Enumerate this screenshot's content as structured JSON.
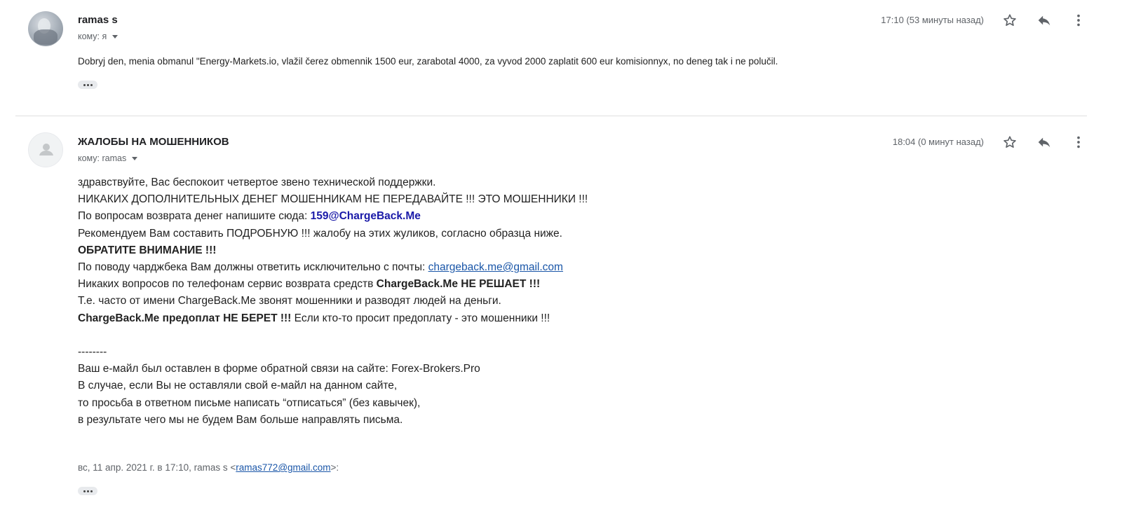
{
  "message1": {
    "sender": "ramas s",
    "to_label": "кому: я",
    "time": "17:10 (53 минуты назад)",
    "body": "Dobryj den, menia obmanul \"Energy-Markets.io, vlažil čerez obmennik 1500 eur, zarabotal 4000, za vyvod 2000 zaplatit 600 eur komisionnyx, no deneg tak i ne polučil."
  },
  "message2": {
    "sender": "ЖАЛОБЫ НА МОШЕННИКОВ",
    "to_label": "кому: ramas",
    "time": "18:04 (0 минут назад)",
    "lines": {
      "l1": "здравствуйте, Вас беспокоит четвертое звено технической поддержки.",
      "l2": "НИКАКИХ ДОПОЛНИТЕЛЬНЫХ ДЕНЕГ МОШЕННИКАМ НЕ ПЕРЕДАВАЙТЕ !!! ЭТО МОШЕННИКИ !!!",
      "l3_prefix": "По вопросам возврата денег напишите сюда: ",
      "l3_email": "159@ChargeBack.Me",
      "l4": "Рекомендуем Вам составить ПОДРОБНУЮ !!! жалобу на этих жуликов, согласно образца ниже.",
      "l5": "ОБРАТИТЕ ВНИМАНИЕ !!!",
      "l6_prefix": "По поводу чарджбека Вам должны ответить исключительно с почты: ",
      "l6_email": "chargeback.me@gmail.com",
      "l7_prefix": "Никаких вопросов по телефонам сервис возврата средств ",
      "l7_bold": "ChargeBack.Me НЕ РЕШАЕТ !!!",
      "l8": "Т.е. часто от имени ChargeBack.Me звонят мошенники и разводят людей на деньги.",
      "l9_bold": "ChargeBack.Me предоплат НЕ БЕРЕТ !!!",
      "l9_suffix": " Если кто-то просит предоплату - это мошенники !!!",
      "sep": "--------",
      "l10": "Ваш е-майл был оставлен в форме обратной связи на сайте: Forex-Brokers.Pro",
      "l11": "В случае, если Вы не оставляли свой е-майл на данном сайте,",
      "l12": "то просьба в ответном письме написать “отписаться” (без кавычек),",
      "l13": "в результате чего мы не будем Вам больше направлять письма."
    },
    "quote_prefix": "вс, 11 апр. 2021 г. в 17:10, ramas s <",
    "quote_email": "ramas772@gmail.com",
    "quote_suffix": ">:"
  },
  "icons": [
    "star-icon",
    "reply-icon",
    "more-vert-icon",
    "person-icon",
    "caret-down-icon",
    "ellipsis-icon"
  ]
}
